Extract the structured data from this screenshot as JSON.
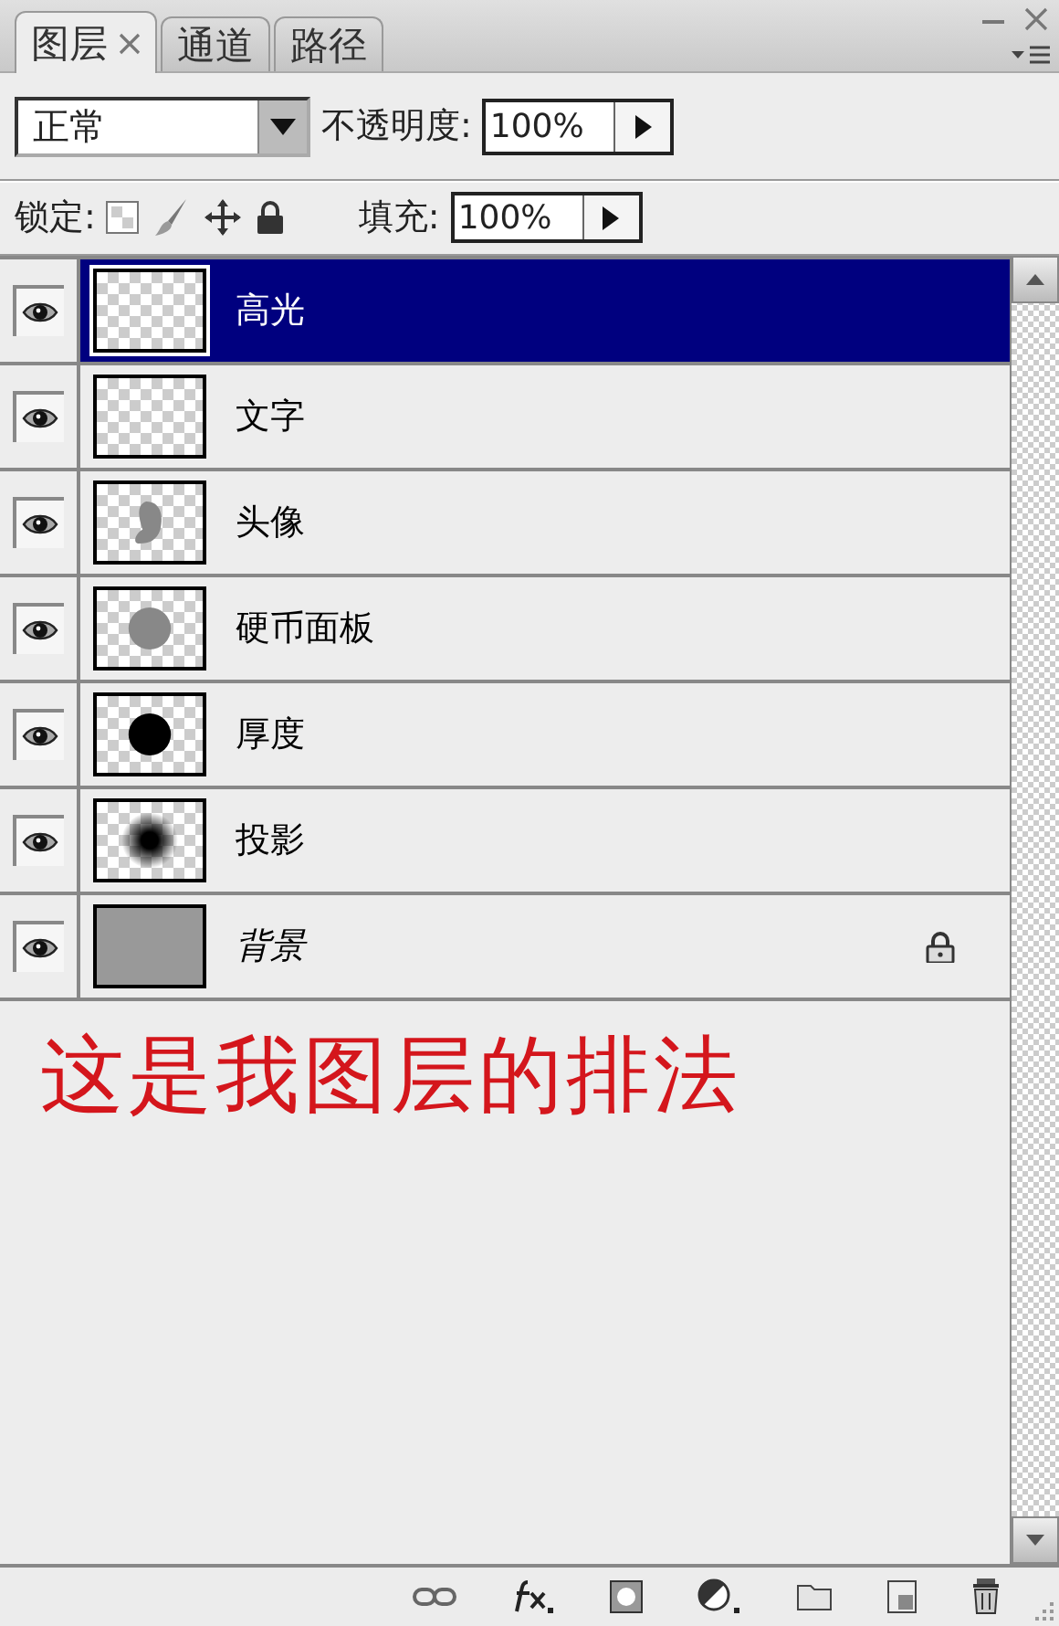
{
  "tabs": [
    {
      "label": "图层",
      "selected": true,
      "closable": true
    },
    {
      "label": "通道",
      "selected": false,
      "closable": false
    },
    {
      "label": "路径",
      "selected": false,
      "closable": false
    }
  ],
  "blend_mode": {
    "value": "正常"
  },
  "opacity": {
    "label": "不透明度:",
    "value": "100%"
  },
  "lock": {
    "label": "锁定:"
  },
  "fill": {
    "label": "填充:",
    "value": "100%"
  },
  "layers": [
    {
      "name": "高光",
      "selected": true,
      "visible": true,
      "locked": false,
      "kind": "empty"
    },
    {
      "name": "文字",
      "selected": false,
      "visible": true,
      "locked": false,
      "kind": "empty"
    },
    {
      "name": "头像",
      "selected": false,
      "visible": true,
      "locked": false,
      "kind": "figure"
    },
    {
      "name": "硬币面板",
      "selected": false,
      "visible": true,
      "locked": false,
      "kind": "disc"
    },
    {
      "name": "厚度",
      "selected": false,
      "visible": true,
      "locked": false,
      "kind": "dark-disc"
    },
    {
      "name": "投影",
      "selected": false,
      "visible": true,
      "locked": false,
      "kind": "soft-disc"
    },
    {
      "name": "背景",
      "selected": false,
      "visible": true,
      "locked": true,
      "kind": "solid"
    }
  ],
  "annotation": "这是我图层的排法"
}
